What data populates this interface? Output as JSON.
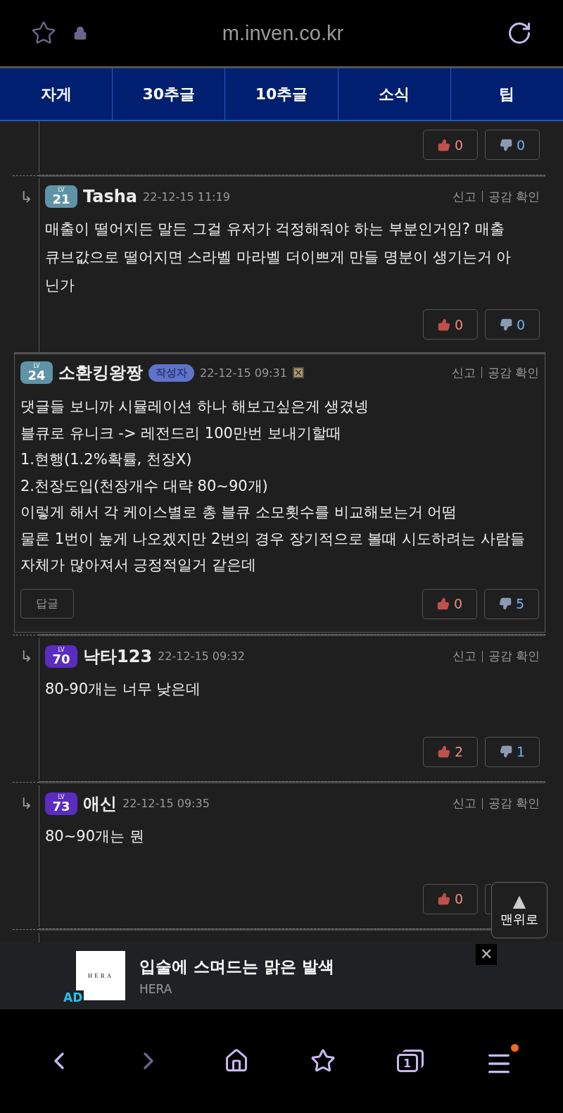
{
  "browser": {
    "url": "m.inven.co.kr"
  },
  "tabs": [
    {
      "label": "자게"
    },
    {
      "label": "30추글"
    },
    {
      "label": "10추글"
    },
    {
      "label": "소식"
    },
    {
      "label": "팁"
    }
  ],
  "comments": [
    {
      "kind": "fragment",
      "likes": "0",
      "dislikes": "0"
    },
    {
      "kind": "reply",
      "arrow": "↳",
      "lv_label": "LV",
      "lv": "21",
      "color": "#5f93a8",
      "author": "Tasha",
      "date": "22-12-15 11:19",
      "report": "신고",
      "empathy": "공감 확인",
      "body": [
        "매출이 떨어지든 말든 그걸 유저가 걱정해줘야 하는 부분인거임? 매출 큐브값으로 떨어지면 스라벨 마라벨 더이쁘게 만들 명분이 생기는거 아닌가"
      ],
      "likes": "0",
      "dislikes": "0"
    },
    {
      "kind": "comment",
      "lv_label": "LV",
      "lv": "24",
      "color": "#5f93a8",
      "author": "소환킹왕짱",
      "writer_tag": "작성자",
      "date": "22-12-15 09:31",
      "report": "신고",
      "empathy": "공감 확인",
      "body": [
        "댓글들 보니까 시뮬레이션 하나 해보고싶은게 생겼넹",
        "블큐로 유니크 -> 레전드리 100만번 보내기할때",
        "1.현행(1.2%확률, 천장X)",
        "2.천장도입(천장개수 대략 80~90개)",
        "이렇게 해서 각 케이스별로 총 블큐 소모횟수를 비교해보는거 어떰",
        "물론 1번이 높게 나오겠지만 2번의 경우 장기적으로 볼때 시도하려는 사람들 자체가 많아져서 긍정적일거 같은데"
      ],
      "reply_button": "답글",
      "likes": "0",
      "dislikes": "5"
    },
    {
      "kind": "reply",
      "arrow": "↳",
      "lv_label": "LV",
      "lv": "70",
      "color": "#5b2cc0",
      "author": "낙타123",
      "date": "22-12-15 09:32",
      "report": "신고",
      "empathy": "공감 확인",
      "body": [
        "80-90개는 너무 낮은데"
      ],
      "likes": "2",
      "dislikes": "1"
    },
    {
      "kind": "reply",
      "arrow": "↳",
      "lv_label": "LV",
      "lv": "73",
      "color": "#5b2cc0",
      "author": "애신",
      "date": "22-12-15 09:35",
      "report": "신고",
      "empathy": "공감 확인",
      "body": [
        "80~90개는 뭔"
      ],
      "likes": "0"
    }
  ],
  "scroll_top": {
    "arrow": "▲",
    "label": "맨위로"
  },
  "ad": {
    "logo": "HERA",
    "badge": "AD",
    "title": "입술에 스며드는 맑은 발색",
    "advertiser": "HERA",
    "close": "✕"
  },
  "bottom_nav": {
    "tab_count": "1",
    "notification": true
  }
}
